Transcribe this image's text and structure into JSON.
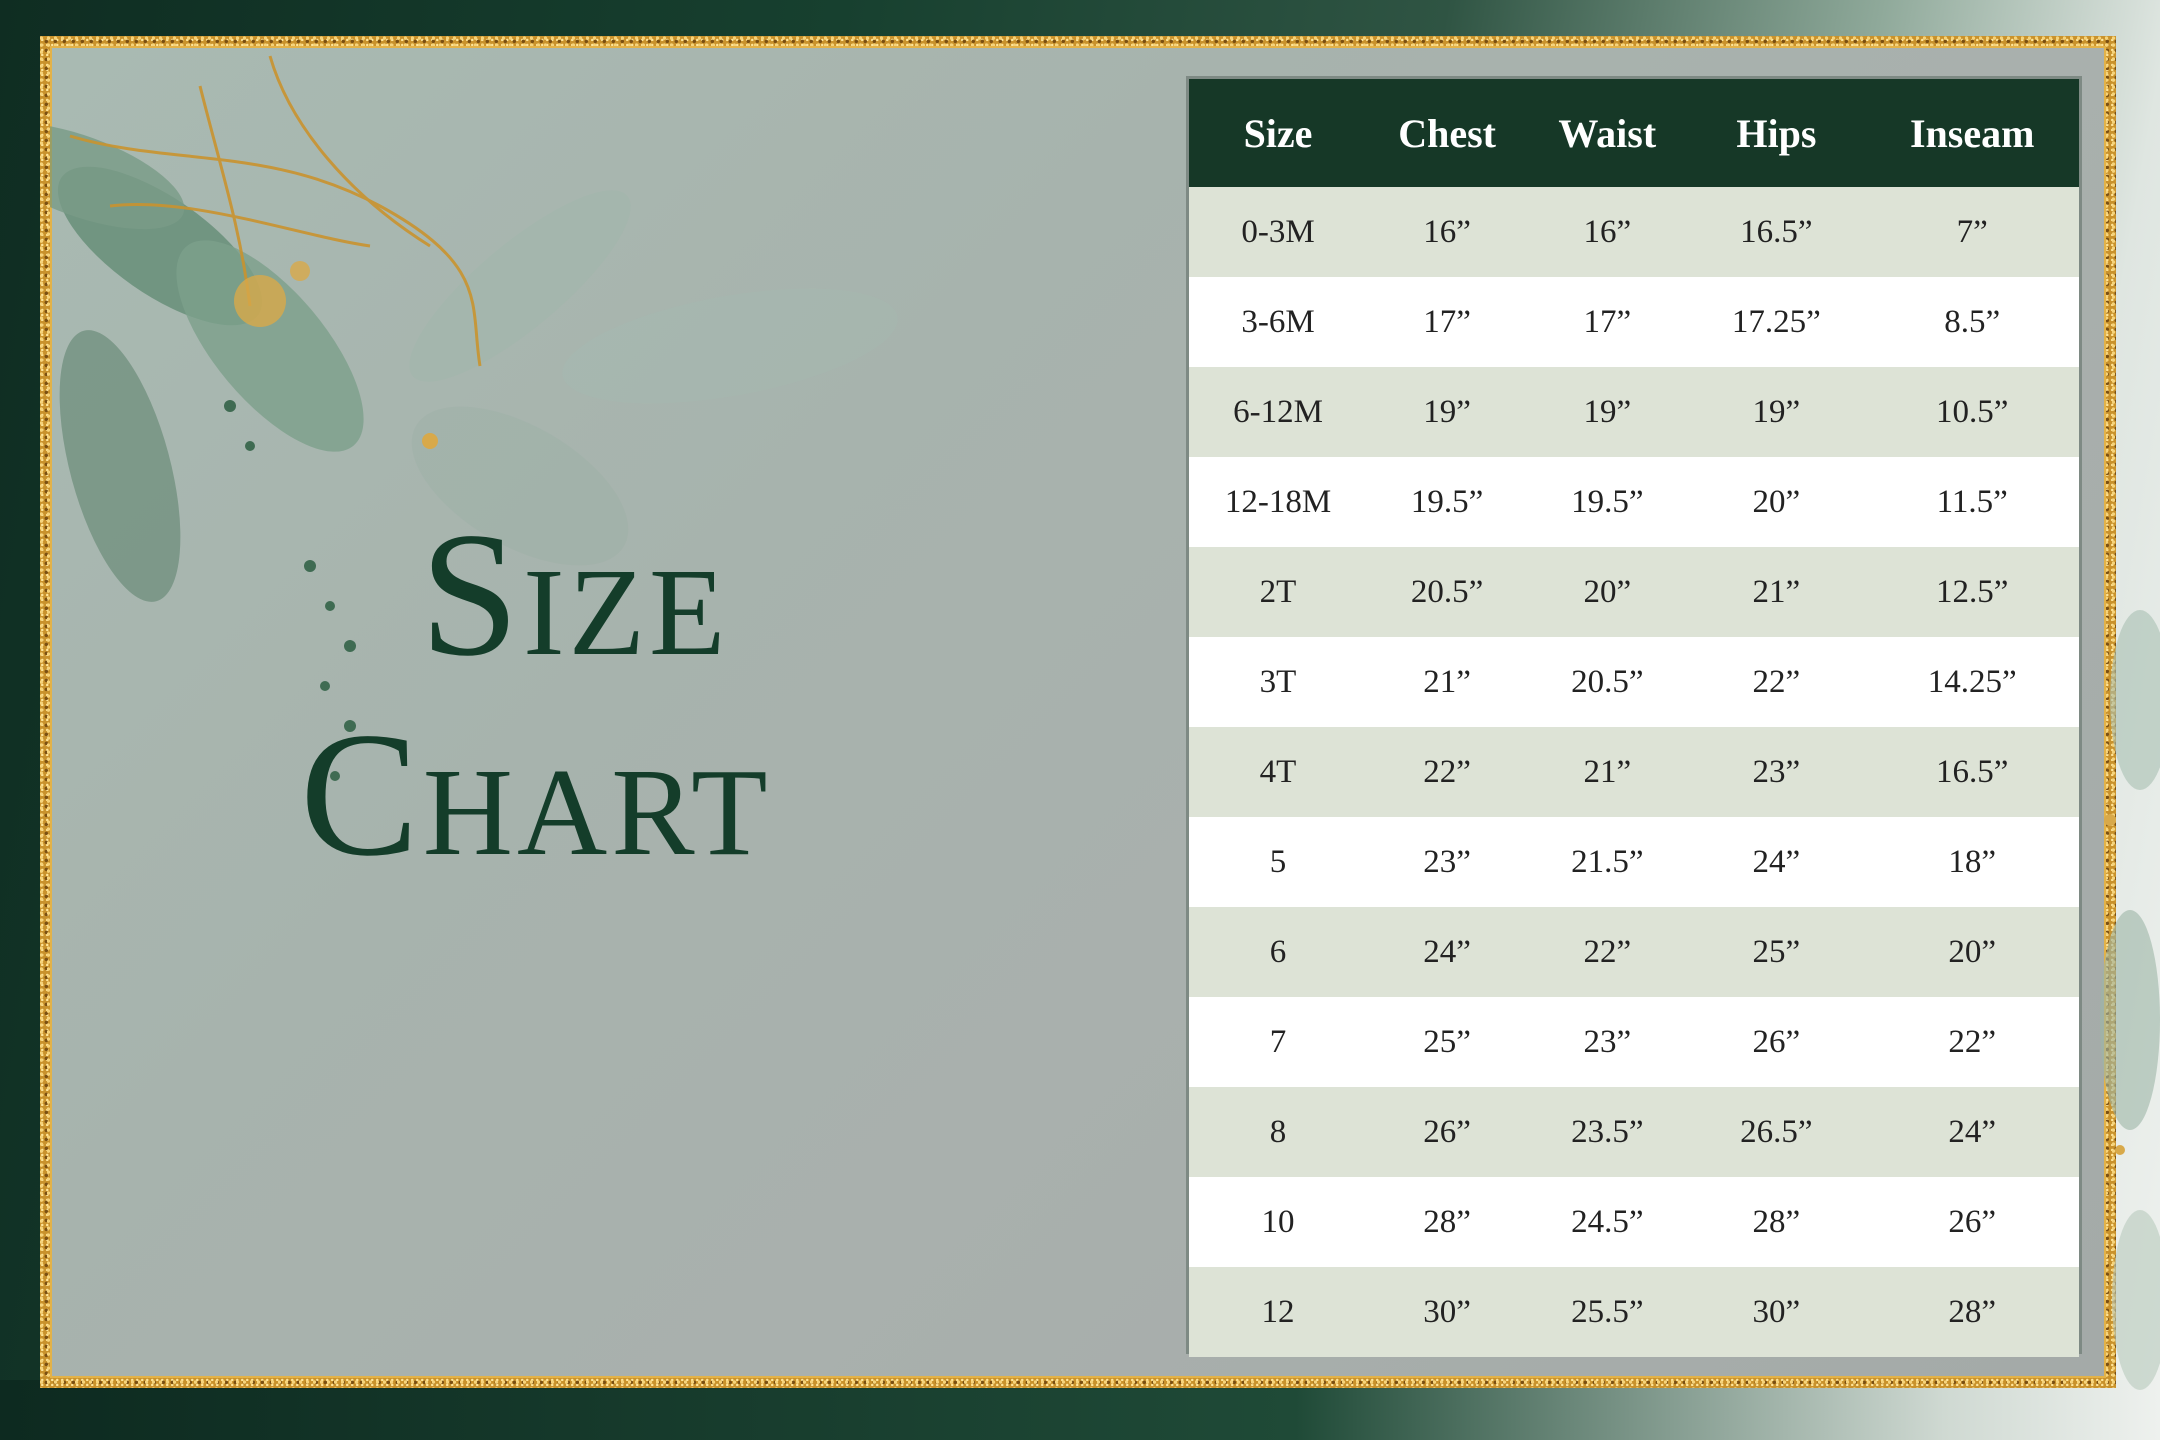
{
  "title": {
    "line1": "Size",
    "line2": "Chart"
  },
  "colors": {
    "accent_green": "#163827",
    "title_green": "#143d2a",
    "gold": "#c9922c",
    "row_shade": "#dde3d6"
  },
  "table": {
    "headers": [
      "Size",
      "Chest",
      "Waist",
      "Hips",
      "Inseam"
    ],
    "rows": [
      [
        "0-3M",
        "16”",
        "16”",
        "16.5”",
        "7”"
      ],
      [
        "3-6M",
        "17”",
        "17”",
        "17.25”",
        "8.5”"
      ],
      [
        "6-12M",
        "19”",
        "19”",
        "19”",
        "10.5”"
      ],
      [
        "12-18M",
        "19.5”",
        "19.5”",
        "20”",
        "11.5”"
      ],
      [
        "2T",
        "20.5”",
        "20”",
        "21”",
        "12.5”"
      ],
      [
        "3T",
        "21”",
        "20.5”",
        "22”",
        "14.25”"
      ],
      [
        "4T",
        "22”",
        "21”",
        "23”",
        "16.5”"
      ],
      [
        "5",
        "23”",
        "21.5”",
        "24”",
        "18”"
      ],
      [
        "6",
        "24”",
        "22”",
        "25”",
        "20”"
      ],
      [
        "7",
        "25”",
        "23”",
        "26”",
        "22”"
      ],
      [
        "8",
        "26”",
        "23.5”",
        "26.5”",
        "24”"
      ],
      [
        "10",
        "28”",
        "24.5”",
        "28”",
        "26”"
      ],
      [
        "12",
        "30”",
        "25.5”",
        "30”",
        "28”"
      ]
    ]
  },
  "decor": {
    "icons": [
      "watercolor-leaves-icon",
      "gold-glitter-frame"
    ]
  }
}
